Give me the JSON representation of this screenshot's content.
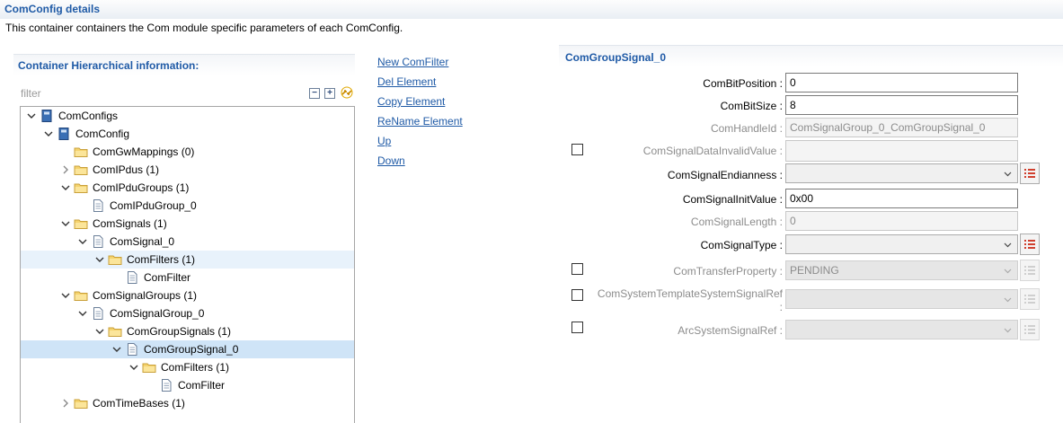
{
  "page": {
    "title": "ComConfig details",
    "description": "This container containers the Com module specific parameters of each ComConfig."
  },
  "tree_panel": {
    "title": "Container Hierarchical information:",
    "filter_placeholder": "filter",
    "nodes": [
      {
        "label": "ComConfigs",
        "level": 0,
        "expander": "expanded",
        "icon": "module-icon"
      },
      {
        "label": "ComConfig",
        "level": 1,
        "expander": "expanded",
        "icon": "module-icon"
      },
      {
        "label": "ComGwMappings (0)",
        "level": 2,
        "expander": "none",
        "icon": "folder-icon"
      },
      {
        "label": "ComIPdus (1)",
        "level": 2,
        "expander": "collapsed",
        "icon": "folder-icon"
      },
      {
        "label": "ComIPduGroups (1)",
        "level": 2,
        "expander": "expanded",
        "icon": "folder-icon"
      },
      {
        "label": "ComIPduGroup_0",
        "level": 3,
        "expander": "none",
        "icon": "document-icon"
      },
      {
        "label": "ComSignals (1)",
        "level": 2,
        "expander": "expanded",
        "icon": "folder-icon"
      },
      {
        "label": "ComSignal_0",
        "level": 3,
        "expander": "expanded",
        "icon": "document-icon"
      },
      {
        "label": "ComFilters (1)",
        "level": 4,
        "expander": "expanded",
        "icon": "folder-icon",
        "state": "hover"
      },
      {
        "label": "ComFilter",
        "level": 5,
        "expander": "none",
        "icon": "document-icon"
      },
      {
        "label": "ComSignalGroups (1)",
        "level": 2,
        "expander": "expanded",
        "icon": "folder-icon"
      },
      {
        "label": "ComSignalGroup_0",
        "level": 3,
        "expander": "expanded",
        "icon": "document-icon"
      },
      {
        "label": "ComGroupSignals (1)",
        "level": 4,
        "expander": "expanded",
        "icon": "folder-icon"
      },
      {
        "label": "ComGroupSignal_0",
        "level": 5,
        "expander": "expanded",
        "icon": "document-icon",
        "state": "selected"
      },
      {
        "label": "ComFilters (1)",
        "level": 6,
        "expander": "expanded",
        "icon": "folder-icon"
      },
      {
        "label": "ComFilter",
        "level": 7,
        "expander": "none",
        "icon": "document-icon"
      },
      {
        "label": "ComTimeBases (1)",
        "level": 2,
        "expander": "collapsed",
        "icon": "folder-icon"
      }
    ]
  },
  "actions": [
    "New ComFilter",
    "Del Element",
    "Copy Element",
    "ReName Element",
    "Up",
    "Down"
  ],
  "detail": {
    "title": "ComGroupSignal_0",
    "fields": {
      "bit_position": {
        "label": "ComBitPosition :",
        "value": "0"
      },
      "bit_size": {
        "label": "ComBitSize :",
        "value": "8"
      },
      "handle_id": {
        "label": "ComHandleId :",
        "value": "ComSignalGroup_0_ComGroupSignal_0"
      },
      "data_invalid_value": {
        "label": "ComSignalDataInvalidValue :",
        "value": ""
      },
      "endianness": {
        "label": "ComSignalEndianness :",
        "value": ""
      },
      "init_value": {
        "label": "ComSignalInitValue :",
        "value": "0x00"
      },
      "signal_length": {
        "label": "ComSignalLength :",
        "value": "0"
      },
      "signal_type": {
        "label": "ComSignalType :",
        "value": ""
      },
      "transfer_property": {
        "label": "ComTransferProperty :",
        "value": "PENDING"
      },
      "system_template_ref": {
        "label": "ComSystemTemplateSystemSignalRef",
        "label_suffix": ":",
        "value": ""
      },
      "arc_system_signal_ref": {
        "label": "ArcSystemSignalRef :",
        "value": ""
      }
    }
  },
  "colors": {
    "accent": "#1f5aa6",
    "selected_row": "#cfe4f7",
    "hover_row": "#e8f2fb",
    "folder": "#f5d36e",
    "list_icon": "#d0402f"
  }
}
